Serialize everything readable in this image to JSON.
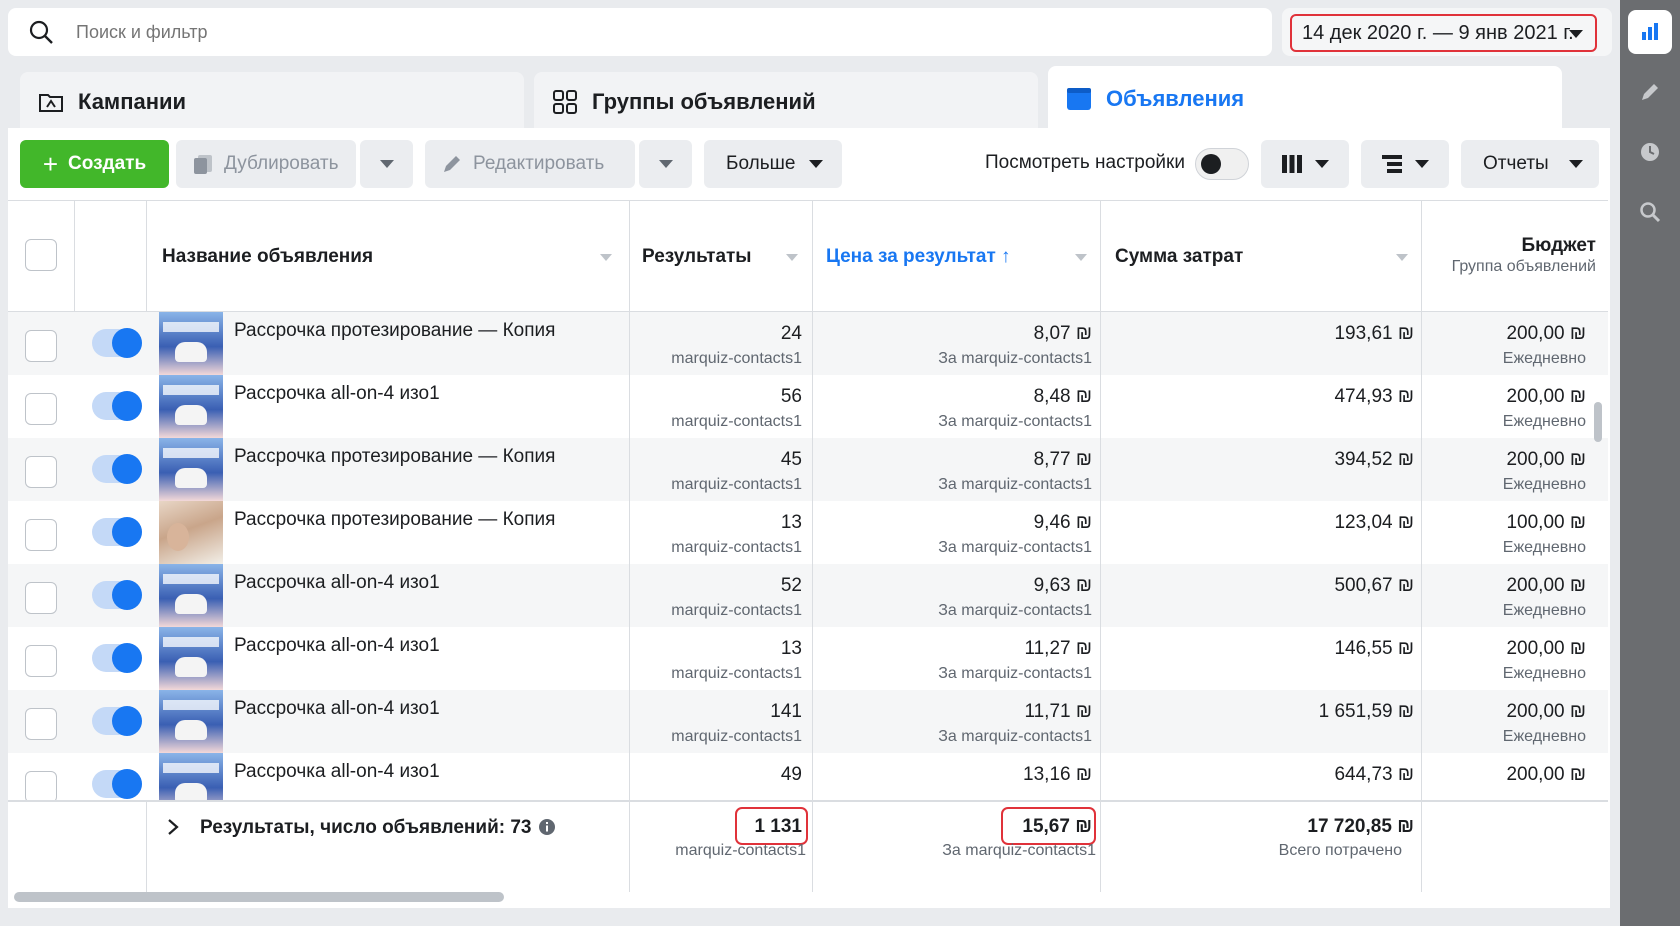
{
  "search": {
    "placeholder": "Поиск и фильтр"
  },
  "date_range": "14 дек 2020 г. — 9 янв 2021 г.",
  "tabs": [
    {
      "label": "Кампании"
    },
    {
      "label": "Группы объявлений"
    },
    {
      "label": "Объявления"
    }
  ],
  "toolbar": {
    "create": "Создать",
    "duplicate": "Дублировать",
    "edit": "Редактировать",
    "more": "Больше",
    "view_settings": "Посмотреть настройки",
    "reports": "Отчеты"
  },
  "columns": {
    "name": "Название объявления",
    "results": "Результаты",
    "cost_per_result": "Цена за результат ↑",
    "amount_spent": "Сумма затрат",
    "budget": "Бюджет",
    "budget_sub": "Группа объявлений"
  },
  "rows": [
    {
      "name": "Рассрочка протезирование — Копия",
      "results": "24",
      "results_sub": "marquiz-contacts1",
      "cpr": "8,07 ₪",
      "cpr_sub": "За marquiz-contacts1",
      "spent": "193,61 ₪",
      "budget": "200,00 ₪",
      "budget_sub": "Ежедневно"
    },
    {
      "name": "Рассрочка all-on-4 изо1",
      "results": "56",
      "results_sub": "marquiz-contacts1",
      "cpr": "8,48 ₪",
      "cpr_sub": "За marquiz-contacts1",
      "spent": "474,93 ₪",
      "budget": "200,00 ₪",
      "budget_sub": "Ежедневно"
    },
    {
      "name": "Рассрочка протезирование — Копия",
      "results": "45",
      "results_sub": "marquiz-contacts1",
      "cpr": "8,77 ₪",
      "cpr_sub": "За marquiz-contacts1",
      "spent": "394,52 ₪",
      "budget": "200,00 ₪",
      "budget_sub": "Ежедневно"
    },
    {
      "name": "Рассрочка протезирование — Копия",
      "results": "13",
      "results_sub": "marquiz-contacts1",
      "cpr": "9,46 ₪",
      "cpr_sub": "За marquiz-contacts1",
      "spent": "123,04 ₪",
      "budget": "100,00 ₪",
      "budget_sub": "Ежедневно"
    },
    {
      "name": "Рассрочка all-on-4 изо1",
      "results": "52",
      "results_sub": "marquiz-contacts1",
      "cpr": "9,63 ₪",
      "cpr_sub": "За marquiz-contacts1",
      "spent": "500,67 ₪",
      "budget": "200,00 ₪",
      "budget_sub": "Ежедневно"
    },
    {
      "name": "Рассрочка all-on-4 изо1",
      "results": "13",
      "results_sub": "marquiz-contacts1",
      "cpr": "11,27 ₪",
      "cpr_sub": "За marquiz-contacts1",
      "spent": "146,55 ₪",
      "budget": "200,00 ₪",
      "budget_sub": "Ежедневно"
    },
    {
      "name": "Рассрочка all-on-4 изо1",
      "results": "141",
      "results_sub": "marquiz-contacts1",
      "cpr": "11,71 ₪",
      "cpr_sub": "За marquiz-contacts1",
      "spent": "1 651,59 ₪",
      "budget": "200,00 ₪",
      "budget_sub": "Ежедневно"
    },
    {
      "name": "Рассрочка all-on-4 изо1",
      "results": "49",
      "results_sub": "",
      "cpr": "13,16 ₪",
      "cpr_sub": "",
      "spent": "644,73 ₪",
      "budget": "200,00 ₪",
      "budget_sub": ""
    }
  ],
  "totals": {
    "label": "Результаты, число объявлений: 73",
    "results": "1 131",
    "results_sub": "marquiz-contacts1",
    "cpr": "15,67 ₪",
    "cpr_sub": "За marquiz-contacts1",
    "spent": "17 720,85 ₪",
    "spent_sub": "Всего потрачено"
  },
  "colors": {
    "accent": "#1877f2",
    "create": "#42b72a",
    "highlight": "#e0323a"
  },
  "icons": [
    "search-icon",
    "chevron-down-icon",
    "folder-icon",
    "grid-icon",
    "ad-icon",
    "plus-icon",
    "duplicate-icon",
    "pencil-icon",
    "columns-icon",
    "breakdown-icon",
    "info-icon",
    "chevron-right-icon",
    "chart-icon",
    "clock-icon",
    "zoom-icon"
  ]
}
